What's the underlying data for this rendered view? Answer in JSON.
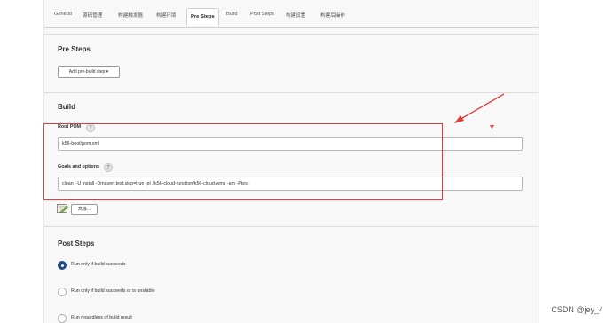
{
  "tabs": [
    {
      "label": "General"
    },
    {
      "label": "源码管理"
    },
    {
      "label": "构建触发器"
    },
    {
      "label": "构建环境"
    },
    {
      "label": "Pre Steps"
    },
    {
      "label": "Build"
    },
    {
      "label": "Post Steps"
    },
    {
      "label": "构建设置"
    },
    {
      "label": "构建后操作"
    }
  ],
  "active_tab": "Pre Steps",
  "pre_steps": {
    "title": "Pre Steps",
    "add_button": "Add pre-build step",
    "add_button_caret": "▾"
  },
  "build": {
    "title": "Build",
    "root_pom_label": "Root POM",
    "root_pom_value": "k56-boot/pom.xml",
    "goals_label": "Goals and options",
    "goals_value": "clean  -U install -Dmaven.test.skip=true -pl ./k56-cloud-function/k56-cloud-wms -am -Ptest",
    "help_glyph": "?",
    "advanced_button": "高级..."
  },
  "post_steps": {
    "title": "Post Steps",
    "options": [
      {
        "label": "Run only if build succeeds",
        "checked": true
      },
      {
        "label": "Run only if build succeeds or is unstable",
        "checked": false
      },
      {
        "label": "Run regardless of build result",
        "checked": false
      }
    ]
  },
  "colors": {
    "annotation": "#e33b3b",
    "radio_checked": "#1f4e87"
  },
  "watermark": "CSDN @jey_4"
}
